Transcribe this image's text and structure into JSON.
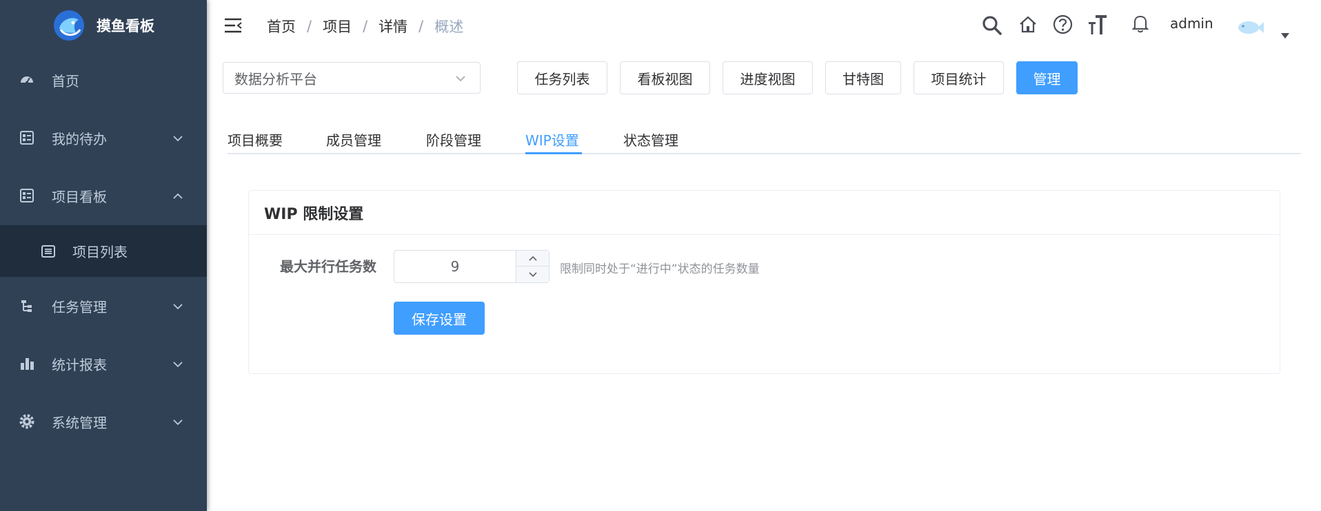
{
  "app": {
    "name": "摸鱼看板"
  },
  "sidebar": {
    "items": [
      {
        "label": "首页",
        "icon": "dashboard-icon"
      },
      {
        "label": "我的待办",
        "icon": "todo-icon",
        "expanded": false
      },
      {
        "label": "项目看板",
        "icon": "kanban-icon",
        "expanded": true
      },
      {
        "label": "任务管理",
        "icon": "tree-icon",
        "expanded": false
      },
      {
        "label": "统计报表",
        "icon": "bar-chart-icon",
        "expanded": false
      },
      {
        "label": "系统管理",
        "icon": "gear-icon",
        "expanded": false
      }
    ],
    "submenu": {
      "label": "项目列表",
      "icon": "list-icon",
      "active": true
    }
  },
  "breadcrumb": [
    "首页",
    "项目",
    "详情",
    "概述"
  ],
  "header": {
    "username": "admin"
  },
  "toolbar": {
    "project_select": "数据分析平台",
    "buttons": [
      "任务列表",
      "看板视图",
      "进度视图",
      "甘特图",
      "项目统计",
      "管理"
    ],
    "active_button": "管理"
  },
  "tabs": [
    "项目概要",
    "成员管理",
    "阶段管理",
    "WIP设置",
    "状态管理"
  ],
  "active_tab": "WIP设置",
  "wip": {
    "title": "WIP 限制设置",
    "field_label": "最大并行任务数",
    "value": "9",
    "hint": "限制同时处于“进行中”状态的任务数量",
    "save_label": "保存设置"
  },
  "colors": {
    "sidebar_bg": "#304156",
    "submenu_bg": "#1f2d3d",
    "primary": "#409eff",
    "menu_text": "#bfcbd9"
  }
}
